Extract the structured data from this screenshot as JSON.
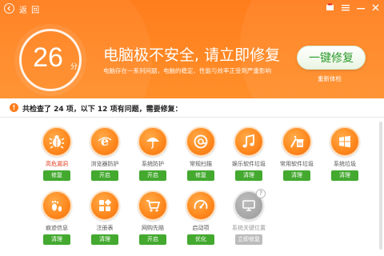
{
  "topbar": {
    "back_label": "返 回",
    "icons": [
      "skin-icon",
      "menu-icon",
      "minimize-icon",
      "close-icon"
    ]
  },
  "score": {
    "value": "26",
    "unit": "分"
  },
  "header": {
    "title": "电脑极不安全, 请立即修复",
    "subtitle": "电脑存在一系列问题，电脑的稳定、性能与效率正受到严重影响",
    "fix_button": "一键修复",
    "recheck_link": "重新体检"
  },
  "summary": {
    "text": "共检查了 24 项，以下 12 项有问题，需要修复："
  },
  "items": [
    {
      "label": "高危漏洞",
      "button": "修复",
      "icon": "bug-icon",
      "state": "alert"
    },
    {
      "label": "浏览器防护",
      "button": "开启",
      "icon": "browser-icon",
      "state": "normal"
    },
    {
      "label": "系统防护",
      "button": "开启",
      "icon": "umbrella-icon",
      "state": "normal"
    },
    {
      "label": "常规扫描",
      "button": "修复",
      "icon": "scan-icon",
      "state": "normal"
    },
    {
      "label": "娱乐软件垃圾",
      "button": "清理",
      "icon": "music-icon",
      "state": "normal"
    },
    {
      "label": "常用软件垃圾",
      "button": "清理",
      "icon": "clean-icon",
      "state": "normal"
    },
    {
      "label": "系统垃圾",
      "button": "清理",
      "icon": "windows-icon",
      "state": "normal"
    },
    {
      "label": "痕迹信息",
      "button": "清理",
      "icon": "footprint-icon",
      "state": "normal"
    },
    {
      "label": "注册表",
      "button": "清理",
      "icon": "registry-icon",
      "state": "normal"
    },
    {
      "label": "网购先赔",
      "button": "开启",
      "icon": "cart-icon",
      "state": "normal"
    },
    {
      "label": "启动项",
      "button": "优化",
      "icon": "speed-icon",
      "state": "normal"
    },
    {
      "label": "系统关键位置",
      "button": "立即修复",
      "icon": "system-icon",
      "state": "disabled"
    }
  ],
  "colors": {
    "header_orange": "#ff7d1c",
    "button_green": "#43a92f",
    "alert_red": "#e23c1c",
    "disabled_gray": "#bcbcbc"
  }
}
